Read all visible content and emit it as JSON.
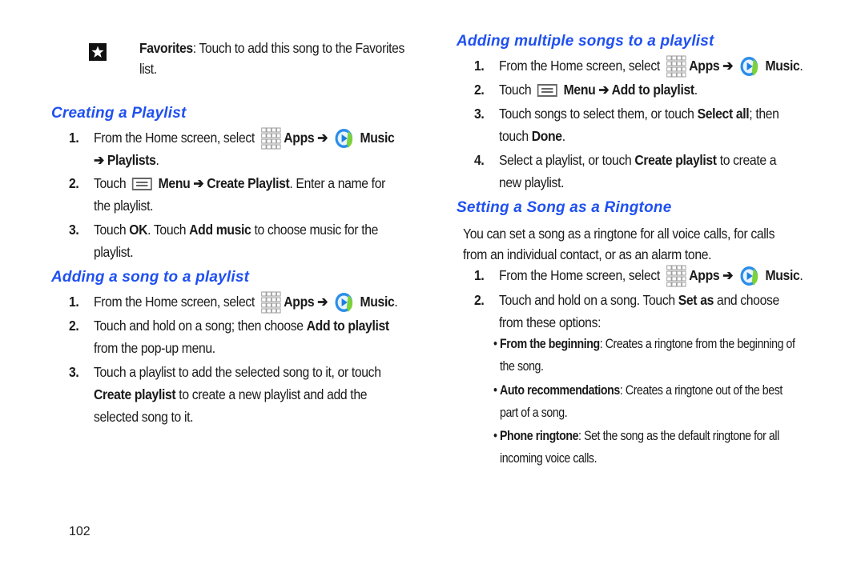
{
  "page_number": "102",
  "colors": {
    "heading": "#1f50f0",
    "text": "#1a1a1a"
  },
  "favorites": {
    "icon": "star-icon",
    "label": "Favorites",
    "line1_rest": ": Touch to add this song to the Favorites",
    "line2": "list."
  },
  "creating_playlist": {
    "title": "Creating a Playlist",
    "steps": [
      {
        "num": "1.",
        "pre": "From the Home screen, select",
        "apps": "Apps ➔",
        "music": "Music",
        "line2": "➔ Playlists",
        "line2_end": "."
      },
      {
        "num": "2.",
        "pre": "Touch",
        "menu": "Menu ➔ Create Playlist",
        "post": ". Enter a name for",
        "line2": "the playlist."
      },
      {
        "num": "3.",
        "pre": "Touch",
        "b1": "OK",
        "mid": ". Touch",
        "b2": "Add music",
        "post": "to choose music for the",
        "line2": "playlist."
      }
    ]
  },
  "adding_song": {
    "title": "Adding a song to a playlist",
    "steps": [
      {
        "num": "1.",
        "pre": "From the Home screen, select",
        "apps": "Apps ➔",
        "music": "Music",
        "end": "."
      },
      {
        "num": "2.",
        "pre": "Touch and hold on a song; then choose",
        "b1": "Add to playlist",
        "line2": "from the pop-up menu."
      },
      {
        "num": "3.",
        "pre": "Touch a playlist to add the selected song to it, or touch",
        "b1": "Create playlist",
        "line2_post": "to create a new playlist and add the",
        "line3": "selected song to it."
      }
    ]
  },
  "adding_multiple": {
    "title": "Adding multiple songs to a playlist",
    "steps": [
      {
        "num": "1.",
        "pre": "From the Home screen, select",
        "apps": "Apps ➔",
        "music": "Music",
        "end": "."
      },
      {
        "num": "2.",
        "pre": "Touch",
        "menu": "Menu ➔ Add to playlist",
        "end": "."
      },
      {
        "num": "3.",
        "pre": "Touch songs to select them, or touch",
        "b1": "Select all",
        "post": "; then",
        "line2_pre": "touch",
        "b2": "Done",
        "line2_end": "."
      },
      {
        "num": "4.",
        "pre": "Select a playlist, or touch",
        "b1": "Create playlist",
        "post": "to create a",
        "line2": "new playlist."
      }
    ]
  },
  "ringtone": {
    "title": "Setting a Song as a Ringtone",
    "intro_line1": "You can set a song as a ringtone for all voice calls, for calls",
    "intro_line2": "from an individual contact, or as an alarm tone.",
    "steps": [
      {
        "num": "1.",
        "pre": "From the Home screen, select",
        "apps": "Apps ➔",
        "music": "Music",
        "end": "."
      },
      {
        "num": "2.",
        "pre": "Touch and hold on a song. Touch",
        "b1": "Set as",
        "post": "and choose",
        "line2": "from these options:"
      }
    ],
    "options": [
      {
        "label": "From the beginning",
        "line1_rest": ": Creates a ringtone from the beginning of",
        "line2": "the song."
      },
      {
        "label": "Auto recommendations",
        "line1_rest": ": Creates a ringtone out of the best",
        "line2": "part of a song."
      },
      {
        "label": "Phone ringtone",
        "line1_rest": ": Set the song as the default ringtone for all",
        "line2": "incoming voice calls."
      }
    ]
  }
}
